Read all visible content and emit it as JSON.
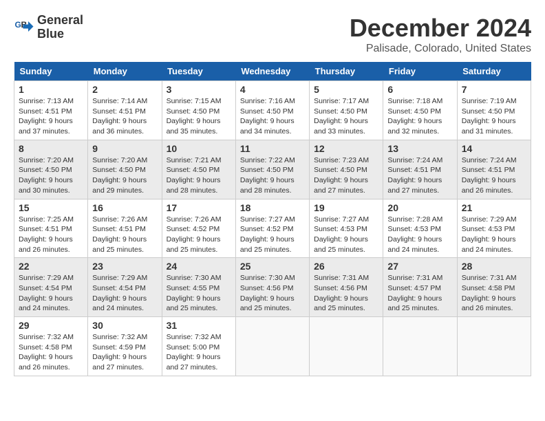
{
  "logo": {
    "line1": "General",
    "line2": "Blue"
  },
  "title": "December 2024",
  "subtitle": "Palisade, Colorado, United States",
  "weekdays": [
    "Sunday",
    "Monday",
    "Tuesday",
    "Wednesday",
    "Thursday",
    "Friday",
    "Saturday"
  ],
  "weeks": [
    [
      {
        "day": "1",
        "info": "Sunrise: 7:13 AM\nSunset: 4:51 PM\nDaylight: 9 hours\nand 37 minutes."
      },
      {
        "day": "2",
        "info": "Sunrise: 7:14 AM\nSunset: 4:51 PM\nDaylight: 9 hours\nand 36 minutes."
      },
      {
        "day": "3",
        "info": "Sunrise: 7:15 AM\nSunset: 4:50 PM\nDaylight: 9 hours\nand 35 minutes."
      },
      {
        "day": "4",
        "info": "Sunrise: 7:16 AM\nSunset: 4:50 PM\nDaylight: 9 hours\nand 34 minutes."
      },
      {
        "day": "5",
        "info": "Sunrise: 7:17 AM\nSunset: 4:50 PM\nDaylight: 9 hours\nand 33 minutes."
      },
      {
        "day": "6",
        "info": "Sunrise: 7:18 AM\nSunset: 4:50 PM\nDaylight: 9 hours\nand 32 minutes."
      },
      {
        "day": "7",
        "info": "Sunrise: 7:19 AM\nSunset: 4:50 PM\nDaylight: 9 hours\nand 31 minutes."
      }
    ],
    [
      {
        "day": "8",
        "info": "Sunrise: 7:20 AM\nSunset: 4:50 PM\nDaylight: 9 hours\nand 30 minutes."
      },
      {
        "day": "9",
        "info": "Sunrise: 7:20 AM\nSunset: 4:50 PM\nDaylight: 9 hours\nand 29 minutes."
      },
      {
        "day": "10",
        "info": "Sunrise: 7:21 AM\nSunset: 4:50 PM\nDaylight: 9 hours\nand 28 minutes."
      },
      {
        "day": "11",
        "info": "Sunrise: 7:22 AM\nSunset: 4:50 PM\nDaylight: 9 hours\nand 28 minutes."
      },
      {
        "day": "12",
        "info": "Sunrise: 7:23 AM\nSunset: 4:50 PM\nDaylight: 9 hours\nand 27 minutes."
      },
      {
        "day": "13",
        "info": "Sunrise: 7:24 AM\nSunset: 4:51 PM\nDaylight: 9 hours\nand 27 minutes."
      },
      {
        "day": "14",
        "info": "Sunrise: 7:24 AM\nSunset: 4:51 PM\nDaylight: 9 hours\nand 26 minutes."
      }
    ],
    [
      {
        "day": "15",
        "info": "Sunrise: 7:25 AM\nSunset: 4:51 PM\nDaylight: 9 hours\nand 26 minutes."
      },
      {
        "day": "16",
        "info": "Sunrise: 7:26 AM\nSunset: 4:51 PM\nDaylight: 9 hours\nand 25 minutes."
      },
      {
        "day": "17",
        "info": "Sunrise: 7:26 AM\nSunset: 4:52 PM\nDaylight: 9 hours\nand 25 minutes."
      },
      {
        "day": "18",
        "info": "Sunrise: 7:27 AM\nSunset: 4:52 PM\nDaylight: 9 hours\nand 25 minutes."
      },
      {
        "day": "19",
        "info": "Sunrise: 7:27 AM\nSunset: 4:53 PM\nDaylight: 9 hours\nand 25 minutes."
      },
      {
        "day": "20",
        "info": "Sunrise: 7:28 AM\nSunset: 4:53 PM\nDaylight: 9 hours\nand 24 minutes."
      },
      {
        "day": "21",
        "info": "Sunrise: 7:29 AM\nSunset: 4:53 PM\nDaylight: 9 hours\nand 24 minutes."
      }
    ],
    [
      {
        "day": "22",
        "info": "Sunrise: 7:29 AM\nSunset: 4:54 PM\nDaylight: 9 hours\nand 24 minutes."
      },
      {
        "day": "23",
        "info": "Sunrise: 7:29 AM\nSunset: 4:54 PM\nDaylight: 9 hours\nand 24 minutes."
      },
      {
        "day": "24",
        "info": "Sunrise: 7:30 AM\nSunset: 4:55 PM\nDaylight: 9 hours\nand 25 minutes."
      },
      {
        "day": "25",
        "info": "Sunrise: 7:30 AM\nSunset: 4:56 PM\nDaylight: 9 hours\nand 25 minutes."
      },
      {
        "day": "26",
        "info": "Sunrise: 7:31 AM\nSunset: 4:56 PM\nDaylight: 9 hours\nand 25 minutes."
      },
      {
        "day": "27",
        "info": "Sunrise: 7:31 AM\nSunset: 4:57 PM\nDaylight: 9 hours\nand 25 minutes."
      },
      {
        "day": "28",
        "info": "Sunrise: 7:31 AM\nSunset: 4:58 PM\nDaylight: 9 hours\nand 26 minutes."
      }
    ],
    [
      {
        "day": "29",
        "info": "Sunrise: 7:32 AM\nSunset: 4:58 PM\nDaylight: 9 hours\nand 26 minutes."
      },
      {
        "day": "30",
        "info": "Sunrise: 7:32 AM\nSunset: 4:59 PM\nDaylight: 9 hours\nand 27 minutes."
      },
      {
        "day": "31",
        "info": "Sunrise: 7:32 AM\nSunset: 5:00 PM\nDaylight: 9 hours\nand 27 minutes."
      },
      {
        "day": "",
        "info": ""
      },
      {
        "day": "",
        "info": ""
      },
      {
        "day": "",
        "info": ""
      },
      {
        "day": "",
        "info": ""
      }
    ]
  ]
}
